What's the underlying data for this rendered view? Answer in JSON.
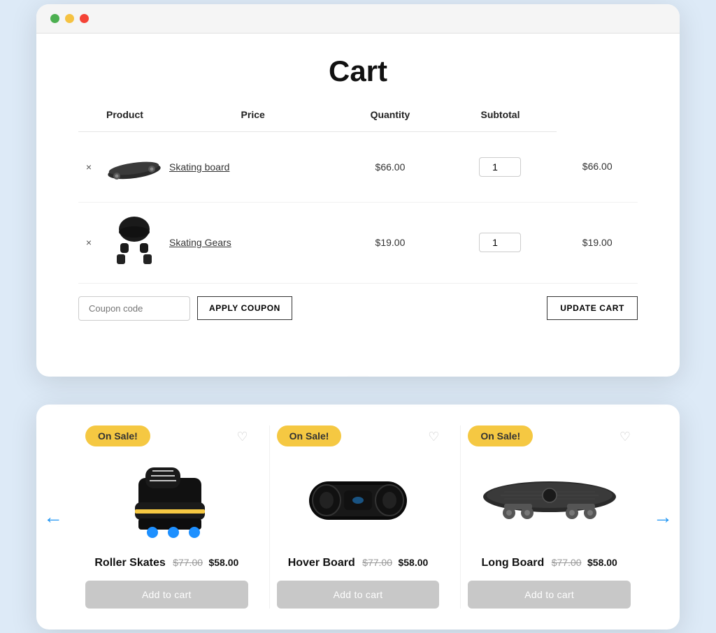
{
  "page": {
    "title": "Cart"
  },
  "cart": {
    "columns": [
      "",
      "Product",
      "Price",
      "Quantity",
      "Subtotal"
    ],
    "items": [
      {
        "id": 1,
        "name": "Skating board",
        "price": "$66.00",
        "quantity": 1,
        "subtotal": "$66.00",
        "emoji": "🛹"
      },
      {
        "id": 2,
        "name": "Skating Gears",
        "price": "$19.00",
        "quantity": 1,
        "subtotal": "$19.00",
        "emoji": "🥋"
      }
    ],
    "coupon_placeholder": "Coupon code",
    "apply_label": "APPLY COUPON",
    "update_label": "UPDATE CART"
  },
  "products": {
    "prev_arrow": "←",
    "next_arrow": "→",
    "sale_badge": "On Sale!",
    "add_to_cart_label": "Add to cart",
    "items": [
      {
        "id": 1,
        "name": "Roller Skates",
        "old_price": "$77.00",
        "new_price": "$58.00",
        "emoji": "🛼"
      },
      {
        "id": 2,
        "name": "Hover Board",
        "old_price": "$77.00",
        "new_price": "$58.00",
        "emoji": "🛹"
      },
      {
        "id": 3,
        "name": "Long Board",
        "old_price": "$77.00",
        "new_price": "$58.00",
        "emoji": "🛹"
      }
    ]
  },
  "browser": {
    "dot1": "green",
    "dot2": "yellow",
    "dot3": "red"
  }
}
